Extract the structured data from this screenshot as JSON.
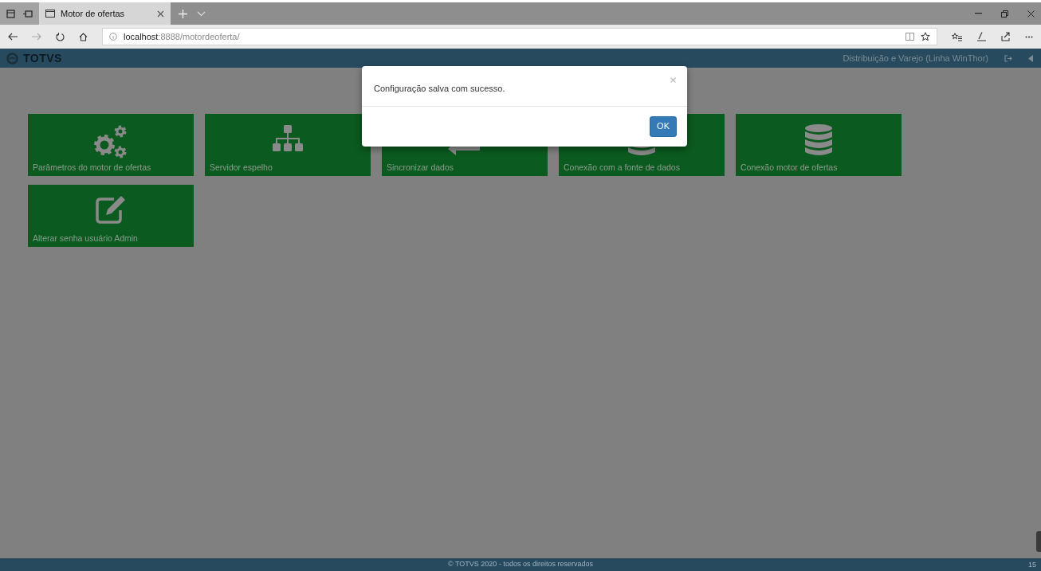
{
  "browser": {
    "tab": {
      "title": "Motor de ofertas",
      "selected": true
    },
    "address": {
      "host": "localhost",
      "path": ":8888/motordeoferta/"
    }
  },
  "navbar": {
    "brand": "TOTVS",
    "company": "Distribuição e Varejo (Linha WinThor)"
  },
  "tiles": [
    {
      "label": "Parâmetros do motor de ofertas",
      "kind": "gears"
    },
    {
      "label": "Servidor espelho",
      "kind": "sitemap"
    },
    {
      "label": "Sincronizar dados",
      "kind": "sync"
    },
    {
      "label": "Conexão com a fonte de dados",
      "kind": "database"
    },
    {
      "label": "Conexão motor de ofertas",
      "kind": "database"
    },
    {
      "label": "Alterar senha usuário Admin",
      "kind": "edit"
    }
  ],
  "modal": {
    "message": "Configuração salva com sucesso.",
    "button": "OK"
  },
  "footer": {
    "copyright": "© TOTVS 2020 - todos os direitos reservados",
    "version": "15"
  }
}
